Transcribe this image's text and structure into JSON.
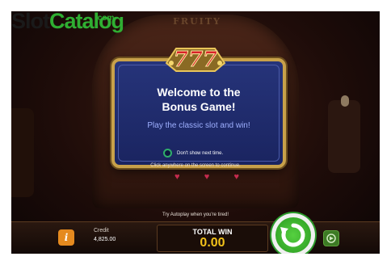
{
  "watermark": {
    "part1": "Slot",
    "part2": "Catalog",
    "part3": ".com"
  },
  "background": {
    "sign_text": "FRUITY"
  },
  "dialog": {
    "badge": "777",
    "title_line1": "Welcome to the",
    "title_line2": "Bonus Game!",
    "subtitle": "Play the classic slot and win!",
    "checkbox_label": "Don't show next time.",
    "checkbox_checked": false
  },
  "hint": "Click anywhere on the screen to continue.",
  "autoplay_tip": "Try Autoplay when you're tired!",
  "bottom_bar": {
    "info_label": "i",
    "credit_label": "Credit",
    "credit_value": "4,825.00",
    "total_win_label": "TOTAL WIN",
    "total_win_value": "0.00"
  },
  "icons": {
    "info": "info-icon",
    "spin": "spin-arrow-icon",
    "autoplay": "autoplay-icon",
    "hearts": "heart-icon"
  },
  "colors": {
    "accent_gold": "#c8a14a",
    "spin_green": "#2fae32",
    "win_yellow": "#f2c21a",
    "info_orange": "#e58a1f",
    "dialog_blue": "#1a2460"
  }
}
